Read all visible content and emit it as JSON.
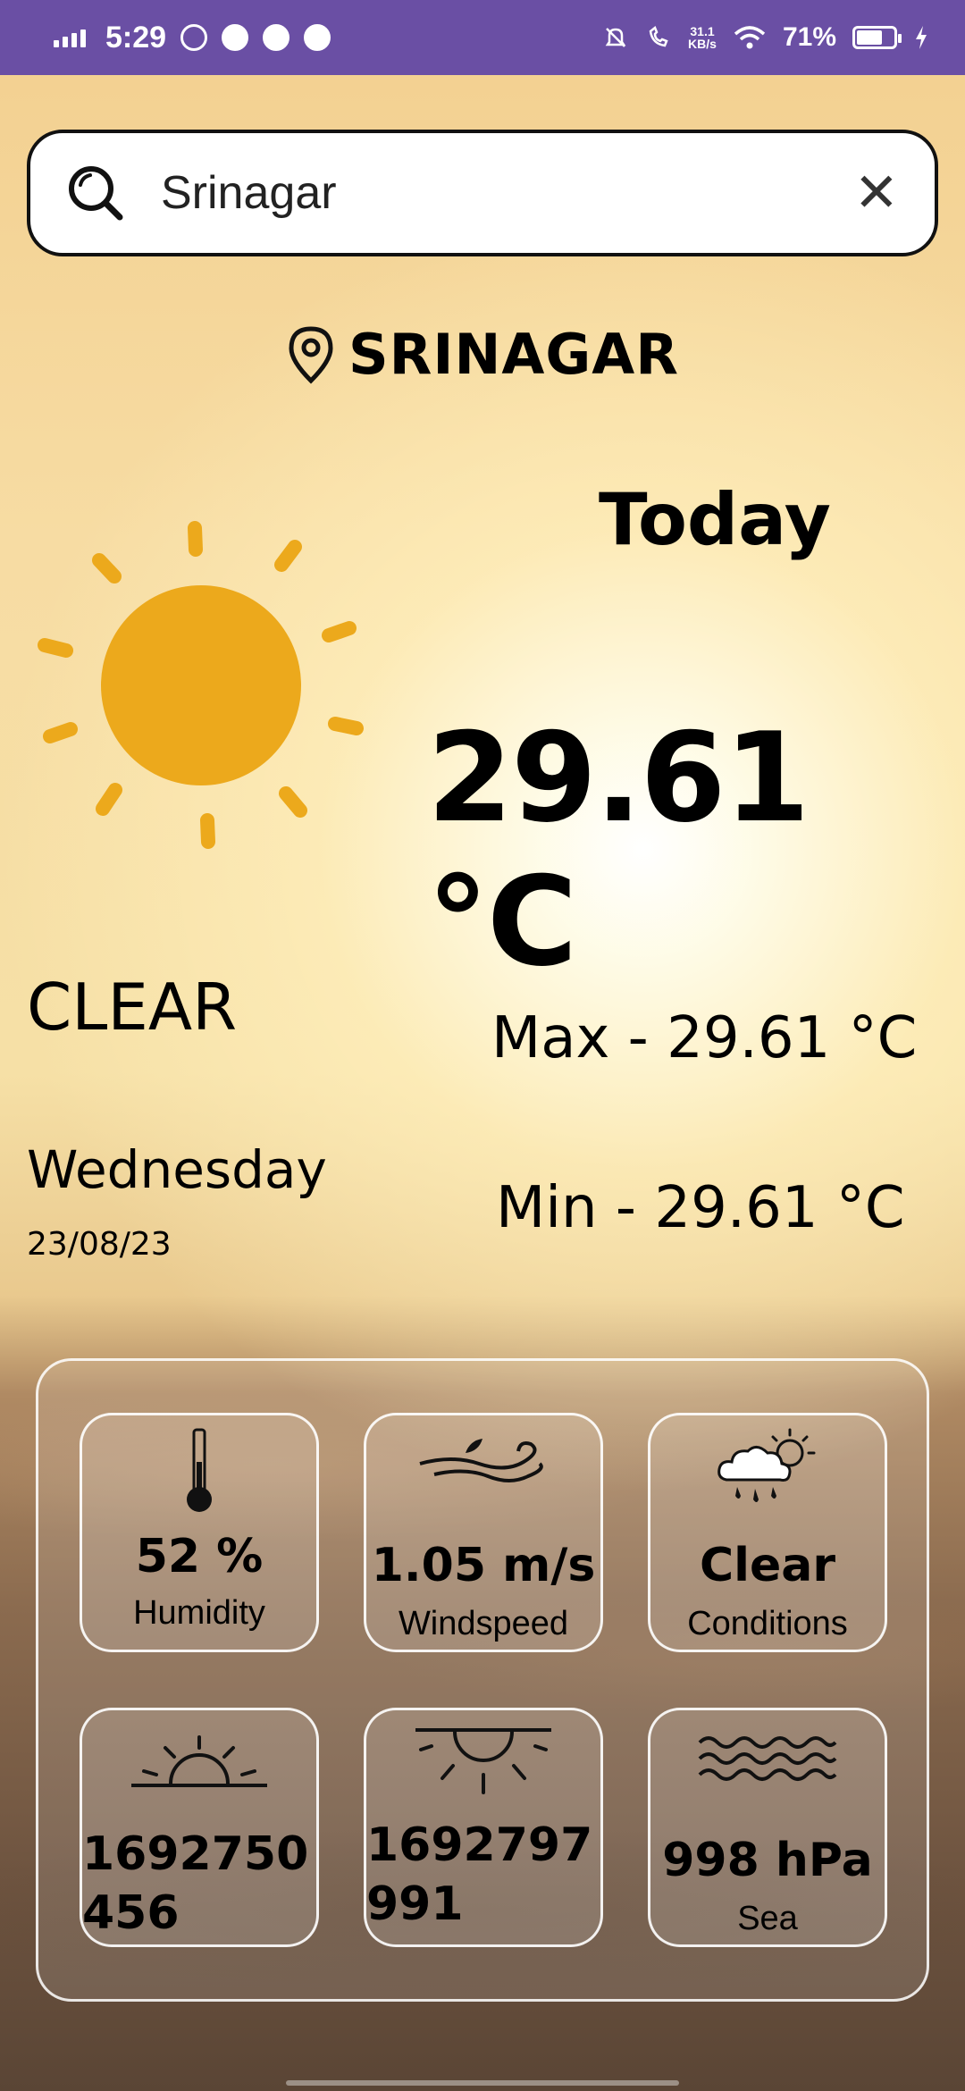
{
  "status_bar": {
    "time": "5:29",
    "network_speed": "31.1",
    "network_unit": "KB/s",
    "battery": "71%",
    "battery_level": 0.71
  },
  "search": {
    "value": "Srinagar"
  },
  "location": {
    "name": "SRINAGAR"
  },
  "weather": {
    "today_label": "Today",
    "temperature": "29.61 °C",
    "condition": "CLEAR",
    "max": "Max - 29.61 °C",
    "min": "Min - 29.61 °C",
    "day": "Wednesday",
    "date": "23/08/23"
  },
  "cards": {
    "humidity": {
      "value": "52 %",
      "label": "Humidity",
      "icon": "thermometer-icon"
    },
    "windspeed": {
      "value": "1.05 m/s",
      "label": "Windspeed",
      "icon": "wind-icon"
    },
    "conditions": {
      "value": "Clear",
      "label": "Conditions",
      "icon": "cloud-rain-sun-icon"
    },
    "sunrise": {
      "value": "1692750456",
      "icon": "sunrise-icon"
    },
    "sunset": {
      "value": "1692797991",
      "icon": "sunset-icon"
    },
    "pressure": {
      "value": "998 hPa",
      "label": "Sea",
      "icon": "waves-icon"
    }
  },
  "colors": {
    "status_bar": "#6a4fa4",
    "sun": "#eca91c"
  }
}
